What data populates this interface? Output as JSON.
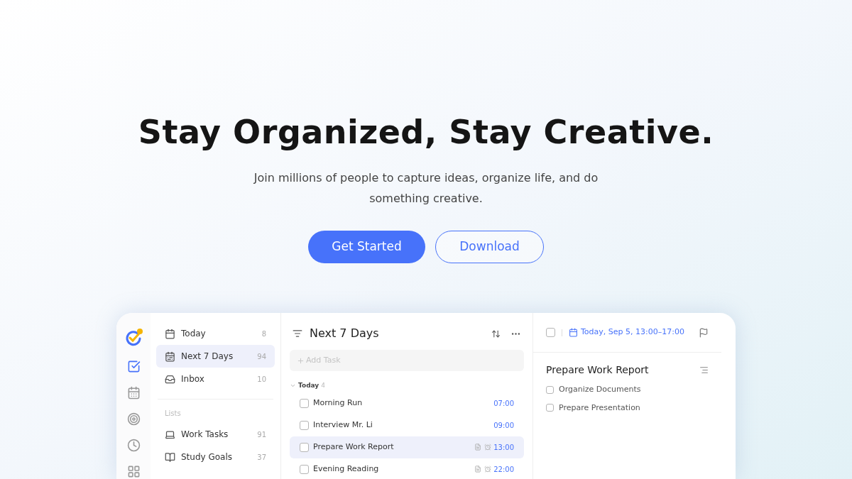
{
  "hero": {
    "title": "Stay Organized, Stay Creative.",
    "subtitle": "Join millions of people to capture ideas, organize life, and do something creative.",
    "buttons": [
      {
        "label": "Get Started",
        "kind": "primary"
      },
      {
        "label": "Download",
        "kind": "outline"
      }
    ]
  },
  "app": {
    "rail": [
      {
        "selected": true
      },
      {
        "selected": false
      },
      {
        "selected": false
      },
      {
        "selected": false
      },
      {
        "selected": false
      }
    ],
    "sidebar": {
      "items": [
        {
          "label": "Today",
          "count": "8",
          "selected": false
        },
        {
          "label": "Next 7 Days",
          "count": "94",
          "selected": true
        },
        {
          "label": "Inbox",
          "count": "10",
          "selected": false
        }
      ],
      "lists_heading": "Lists",
      "lists": [
        {
          "label": "Work Tasks",
          "count": "91",
          "selected": false
        },
        {
          "label": "Study Goals",
          "count": "37",
          "selected": false
        }
      ]
    },
    "tasks": {
      "title": "Next 7 Days",
      "add_placeholder": "Add Task",
      "group": {
        "label": "Today",
        "count": "4",
        "expanded": true
      },
      "rows": [
        {
          "title": "Morning Run",
          "time": "07:00",
          "checked": false,
          "selected": false,
          "note": false,
          "reminder": false
        },
        {
          "title": "Interview Mr. Li",
          "time": "09:00",
          "checked": false,
          "selected": false,
          "note": false,
          "reminder": false
        },
        {
          "title": "Prepare Work Report",
          "time": "13:00",
          "checked": false,
          "selected": true,
          "note": true,
          "reminder": true
        },
        {
          "title": "Evening Reading",
          "time": "22:00",
          "checked": false,
          "selected": false,
          "note": true,
          "reminder": true
        }
      ]
    },
    "detail": {
      "checked": false,
      "date": "Today, Sep 5, 13:00–17:00",
      "title": "Prepare Work Report",
      "subtasks": [
        {
          "label": "Organize Documents",
          "checked": false
        },
        {
          "label": "Prepare Presentation",
          "checked": false
        }
      ]
    }
  }
}
